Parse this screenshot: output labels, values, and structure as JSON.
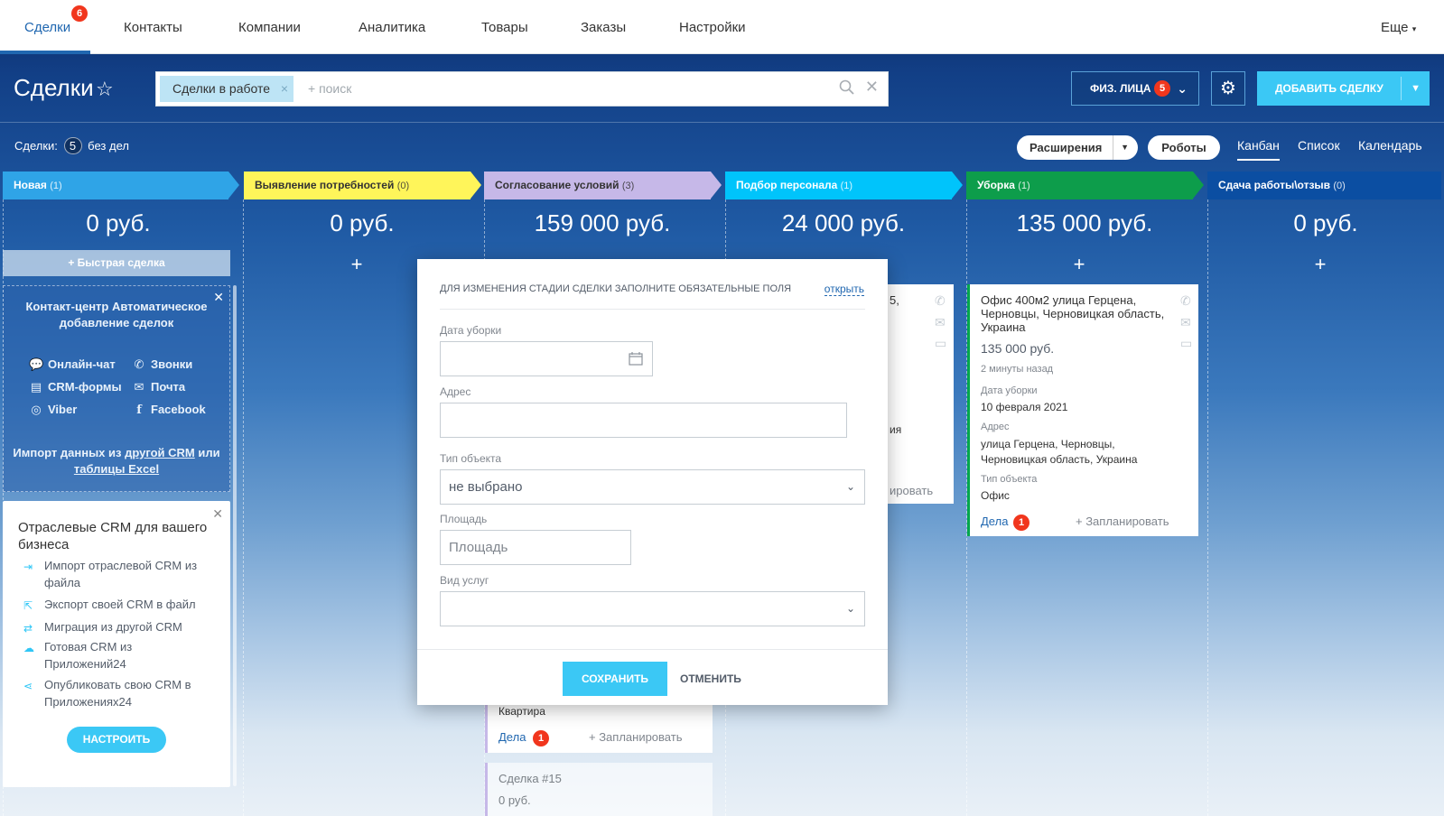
{
  "topnav": {
    "items": [
      "Сделки",
      "Контакты",
      "Компании",
      "Аналитика",
      "Товары",
      "Заказы",
      "Настройки"
    ],
    "deals_badge": "6",
    "more": "Еще"
  },
  "header": {
    "title": "Сделки",
    "filter_chip": "Сделки в работе",
    "search_placeholder": "+ поиск",
    "category_button": "ФИЗ. ЛИЦА",
    "category_badge": "5",
    "add_button": "ДОБАВИТЬ СДЕЛКУ"
  },
  "subbar": {
    "deals_label": "Сделки:",
    "deals_count": "5",
    "deals_suffix": "без дел",
    "extensions": "Расширения",
    "robots": "Роботы",
    "views": [
      "Канбан",
      "Список",
      "Календарь"
    ]
  },
  "stages": [
    {
      "name": "Новая",
      "count": "(1)",
      "sum": "0 руб.",
      "color": "#2fa4e7"
    },
    {
      "name": "Выявление потребностей",
      "count": "(0)",
      "sum": "0 руб.",
      "color": "#fff55a"
    },
    {
      "name": "Согласование условий",
      "count": "(3)",
      "sum": "159 000 руб.",
      "color": "#c6b8e8"
    },
    {
      "name": "Подбор персонала",
      "count": "(1)",
      "sum": "24 000 руб.",
      "color": "#00c4fb"
    },
    {
      "name": "Уборка",
      "count": "(1)",
      "sum": "135 000 руб.",
      "color": "#0d9d4b"
    },
    {
      "name": "Сдача работы\\отзыв",
      "count": "(0)",
      "sum": "0 руб.",
      "color": "#0b4ea2"
    }
  ],
  "quick_deal": "+ Быстрая сделка",
  "contact_center": {
    "title": "Контакт-центр Автоматическое добавление сделок",
    "channels": [
      "Онлайн-чат",
      "Звонки",
      "CRM-формы",
      "Почта",
      "Viber",
      "Facebook"
    ],
    "import_text": "Импорт данных из",
    "import_link1": "другой CRM",
    "import_or": "или",
    "import_link2": "таблицы Excel"
  },
  "industry": {
    "title": "Отраслевые CRM для вашего бизнеса",
    "items": [
      "Импорт отраслевой CRM из файла",
      "Экспорт своей CRM в файл",
      "Миграция из другой CRM",
      "Готовая CRM из Приложений24",
      "Опубликовать свою CRM в Приложениях24"
    ],
    "button": "НАСТРОИТЬ"
  },
  "card_uborka": {
    "title": "Офис 400м2 улица Герцена, Черновцы, Черновицкая область, Украина",
    "price": "135 000 руб.",
    "time": "2 минуты назад",
    "date_label": "Дата уборки",
    "date_value": "10 февраля 2021",
    "address_label": "Адрес",
    "address_value": "улица Герцена, Черновцы, Черновицкая область, Украина",
    "type_label": "Тип объекта",
    "type_value": "Офис",
    "tasks": "Дела",
    "tasks_badge": "1",
    "plan": "+ Запланировать"
  },
  "card_podbor": {
    "title_frag": "5,",
    "addr_frag": "ия",
    "plan_frag": "ировать"
  },
  "card_soglas": {
    "type_value": "Квартира",
    "tasks": "Дела",
    "tasks_badge": "1",
    "plan": "+ Запланировать",
    "next_title": "Сделка #15",
    "next_price": "0 руб."
  },
  "modal": {
    "heading": "ДЛЯ ИЗМЕНЕНИЯ СТАДИИ СДЕЛКИ ЗАПОЛНИТЕ ОБЯЗАТЕЛЬНЫЕ ПОЛЯ",
    "open": "открыть",
    "date_label": "Дата уборки",
    "address_label": "Адрес",
    "type_label": "Тип объекта",
    "type_value": "не выбрано",
    "area_label": "Площадь",
    "area_placeholder": "Площадь",
    "services_label": "Вид услуг",
    "save": "СОХРАНИТЬ",
    "cancel": "ОТМЕНИТЬ"
  },
  "colors": {
    "accent": "#3bc8f5",
    "link": "#2067b0",
    "badge": "#f1361d"
  }
}
